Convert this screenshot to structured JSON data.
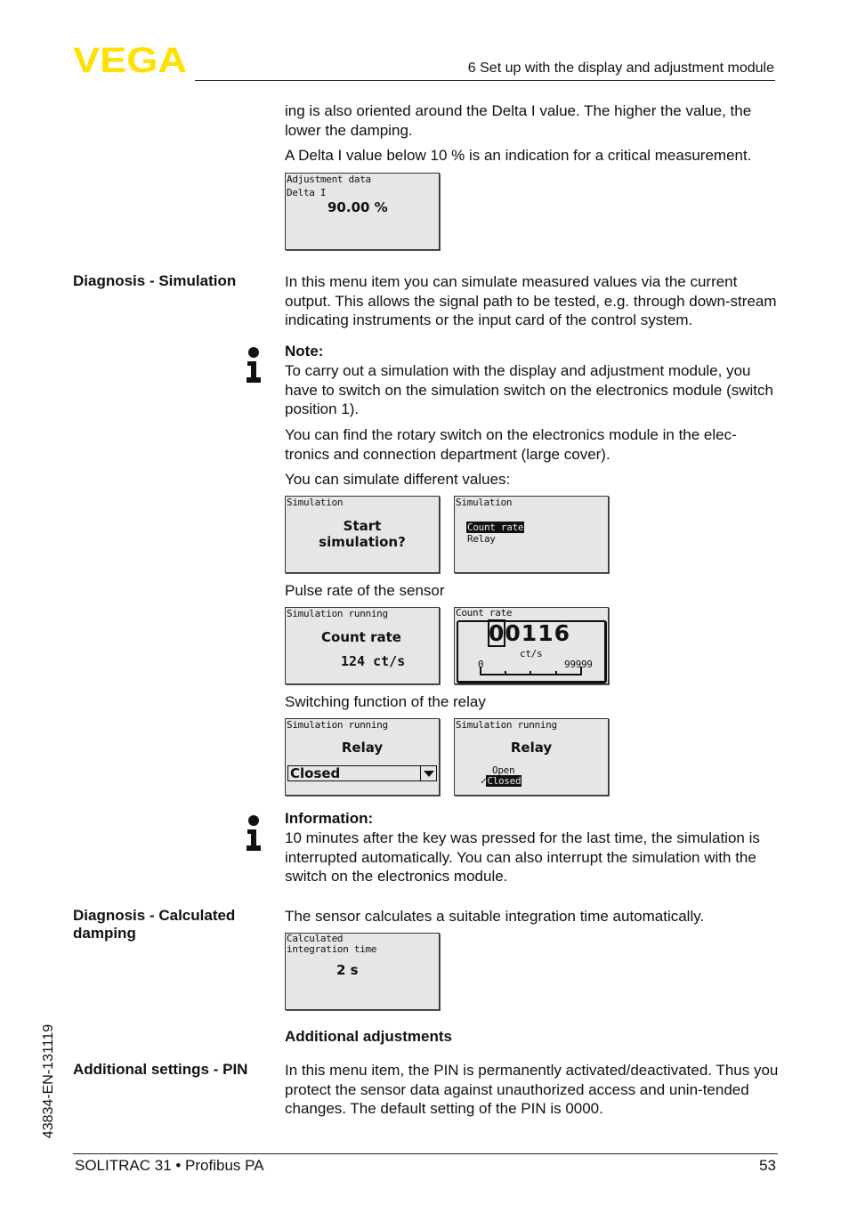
{
  "header": {
    "logo_text": "VEGA",
    "brand_color": "#FFE000",
    "section_title": "6 Set up with the display and adjustment module"
  },
  "intro": {
    "paragraph1": "ing is also oriented around the Delta I value. The higher the value, the lower the damping.",
    "paragraph2": "A Delta I value below 10 % is an indication for a critical measurement."
  },
  "display_delta": {
    "line1": "Adjustment data",
    "line2": "Delta I",
    "value": "90.00 %"
  },
  "simulation": {
    "label": "Diagnosis - Simulation",
    "text": "In this menu item you can simulate measured values via the current output. This allows the signal path to be tested, e.g. through down-stream indicating instruments or the input card of the control system.",
    "note_title": "Note:",
    "note_text": "To carry out a simulation with the display and adjustment module, you have to switch on the simulation switch on the electronics module (switch position 1).",
    "note_text2": "You can find the rotary switch on the electronics module in the elec-tronics and connection department (large cover).",
    "note_text3": "You can simulate different values:",
    "display_start": {
      "title": "Simulation",
      "line1": "Start",
      "line2": "simulation?"
    },
    "display_menu": {
      "title": "Simulation",
      "items": [
        "Count rate",
        "Relay"
      ],
      "selected": "Count rate"
    },
    "caption_pulse": "Pulse rate of the sensor",
    "display_running_count": {
      "title": "Simulation running",
      "label": "Count rate",
      "value": "124 ct/s"
    },
    "display_count_edit": {
      "title": "Count rate",
      "value": "00116",
      "cursor_digit": "0",
      "rest_digits": "0116",
      "unit": "ct/s",
      "scale_min": "0",
      "scale_max": "99999"
    },
    "caption_relay": "Switching function of the relay",
    "display_relay_dropdown": {
      "title": "Simulation running",
      "label": "Relay",
      "selected": "Closed"
    },
    "display_relay_list": {
      "title": "Simulation running",
      "label": "Relay",
      "options": [
        "Open",
        "Closed"
      ],
      "selected": "Closed",
      "check_glyph": "✓"
    },
    "info_title": "Information:",
    "info_text": "10 minutes after the key was pressed for the last time, the simulation is interrupted automatically. You can also interrupt the simulation with the switch on the electronics module."
  },
  "calculated_damping": {
    "label": "Diagnosis - Calculated damping",
    "text": "The sensor calculates a suitable integration time automatically.",
    "display": {
      "line1": "Calculated",
      "line2": "integration time",
      "value": "2 s"
    }
  },
  "additional": {
    "heading": "Additional adjustments",
    "pin_label": "Additional settings - PIN",
    "pin_text": "In this menu item, the PIN is permanently activated/deactivated. Thus you protect the sensor data against unauthorized access and unin-tended changes. The default setting of the PIN is 0000."
  },
  "footer": {
    "product": "SOLITRAC 31 • Profibus PA",
    "page_number": "53",
    "doc_id": "43834-EN-131119"
  }
}
